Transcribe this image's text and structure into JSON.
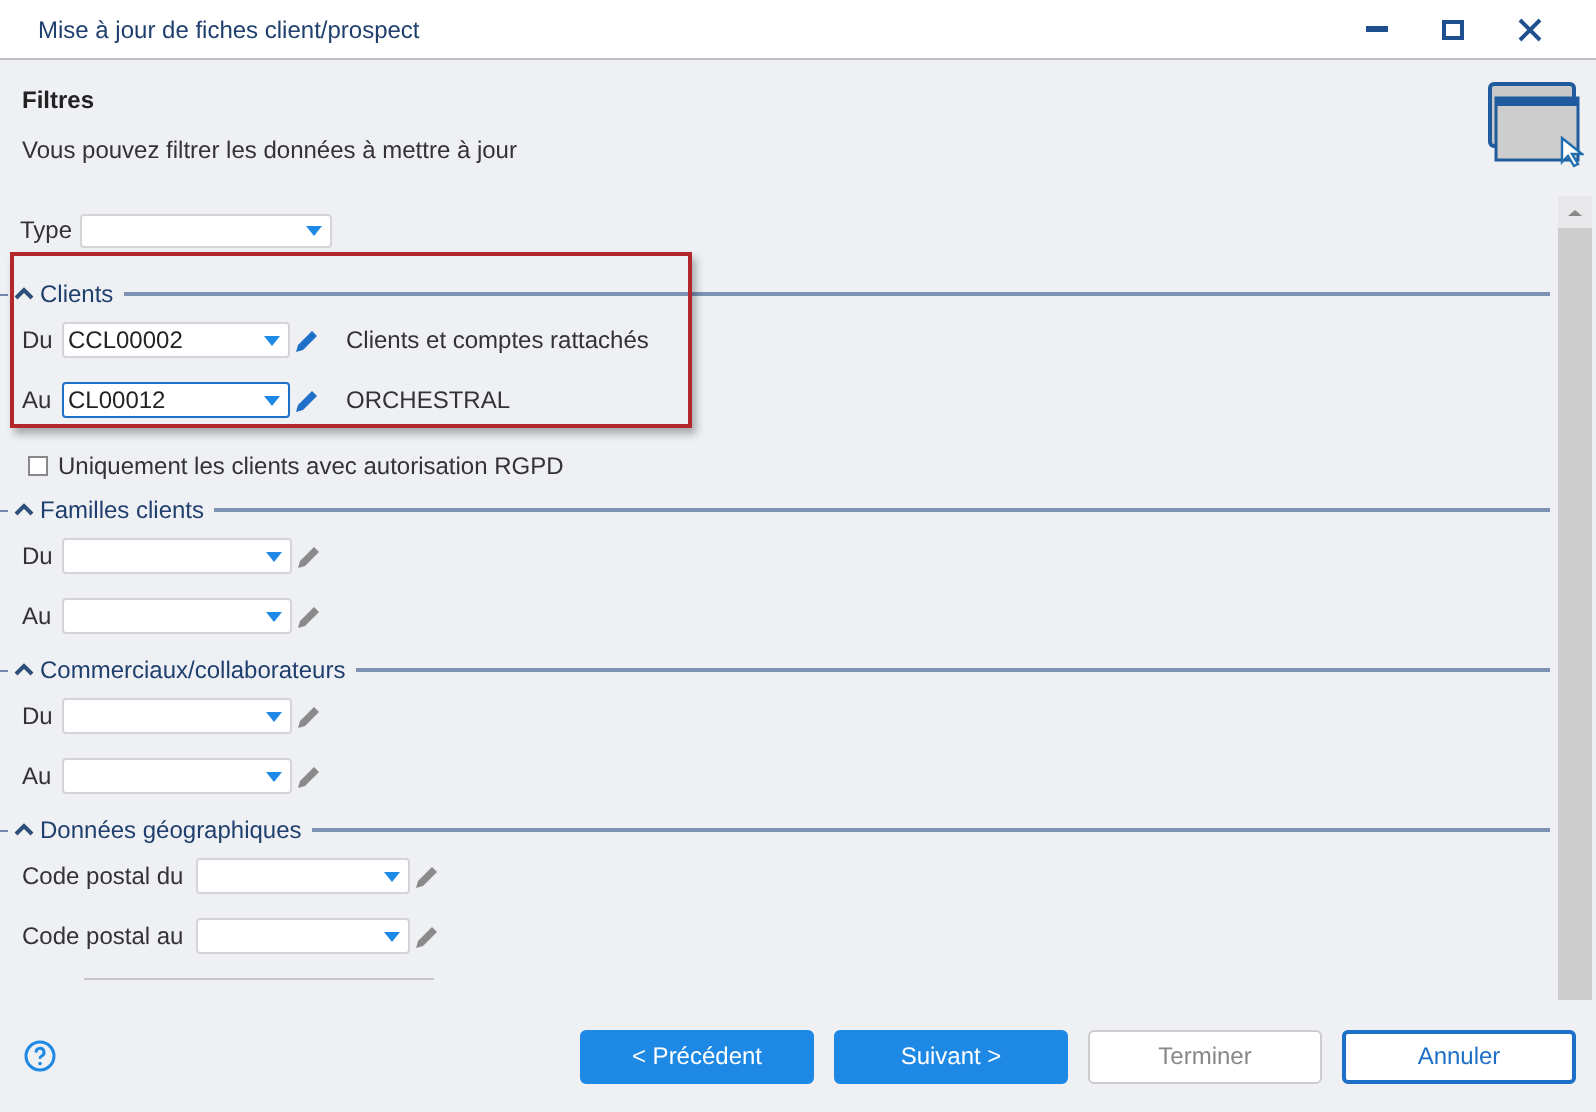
{
  "window": {
    "title": "Mise à jour de fiches client/prospect"
  },
  "header": {
    "title": "Filtres",
    "subtitle": "Vous pouvez filtrer les données à mettre à jour"
  },
  "type_field": {
    "label": "Type"
  },
  "sections": [
    {
      "kind": "range",
      "title": "Clients",
      "expanded": true,
      "highlighted": true,
      "rows": [
        {
          "label": "Du",
          "value": "CCL00002",
          "focused": false,
          "description": "Clients et comptes rattachés"
        },
        {
          "label": "Au",
          "value": "CL00012",
          "focused": true,
          "description": "ORCHESTRAL"
        }
      ]
    },
    {
      "kind": "checkbox",
      "label": "Uniquement les clients avec autorisation RGPD",
      "checked": false
    },
    {
      "kind": "range",
      "title": "Familles clients",
      "expanded": true,
      "rows": [
        {
          "label": "Du",
          "value": "",
          "focused": false
        },
        {
          "label": "Au",
          "value": "",
          "focused": false
        }
      ]
    },
    {
      "kind": "range",
      "title": "Commerciaux/collaborateurs",
      "expanded": true,
      "rows": [
        {
          "label": "Du",
          "value": "",
          "focused": false
        },
        {
          "label": "Au",
          "value": "",
          "focused": false
        }
      ]
    },
    {
      "kind": "wide_range",
      "title": "Données géographiques",
      "expanded": true,
      "rows": [
        {
          "label": "Code postal du",
          "value": "",
          "focused": false
        },
        {
          "label": "Code postal au",
          "value": "",
          "focused": false
        }
      ]
    }
  ],
  "buttons": [
    {
      "label": "< Précédent",
      "kind": "primary",
      "disabled": false
    },
    {
      "label": "Suivant >",
      "kind": "primary",
      "disabled": false
    },
    {
      "label": "Terminer",
      "kind": "secondary",
      "disabled": true
    },
    {
      "label": "Annuler",
      "kind": "outline",
      "disabled": false
    }
  ]
}
